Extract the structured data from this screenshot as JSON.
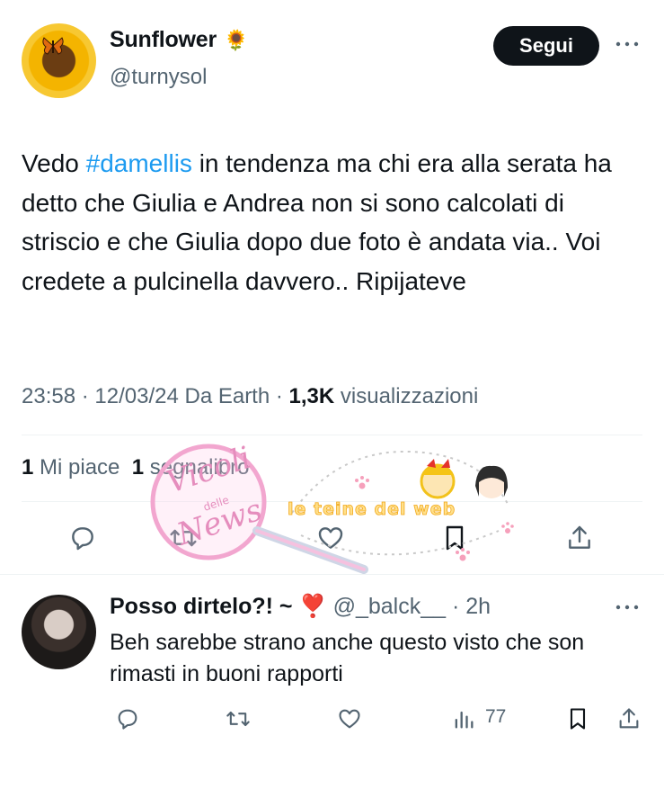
{
  "tweet": {
    "author_name": "Sunflower",
    "author_emoji": "🌻",
    "author_handle": "@turnysol",
    "follow_label": "Segui",
    "text_before_hashtag": "Vedo ",
    "hashtag": "#damellis",
    "text_after_hashtag": " in tendenza ma chi era alla serata ha detto che Giulia e Andrea non si sono calcolati di striscio e che Giulia dopo due foto è andata via.. Voi credete a pulcinella davvero.. Ripijateve",
    "time": "23:58",
    "date": "12/03/24",
    "source": "Da Earth",
    "views_count": "1,3K",
    "views_label": "visualizzazioni",
    "likes_count": "1",
    "likes_label": "Mi piace",
    "bookmarks_count": "1",
    "bookmarks_label": "segnalibro"
  },
  "reply": {
    "author_name": "Posso dirtelo?! ~",
    "author_emoji": "❣️",
    "author_handle": "@_balck__",
    "time": "2h",
    "text": "Beh sarebbe strano anche questo visto che son rimasti in buoni rapporti",
    "views": "77"
  },
  "watermark": {
    "text_left_1": "Vicoli",
    "text_left_2": "delle",
    "text_left_3": "News",
    "text_right": "le teine del web"
  },
  "colors": {
    "accent": "#1d9bf0",
    "text": "#0f1419",
    "secondary": "#536471",
    "divider": "#eff3f4"
  }
}
